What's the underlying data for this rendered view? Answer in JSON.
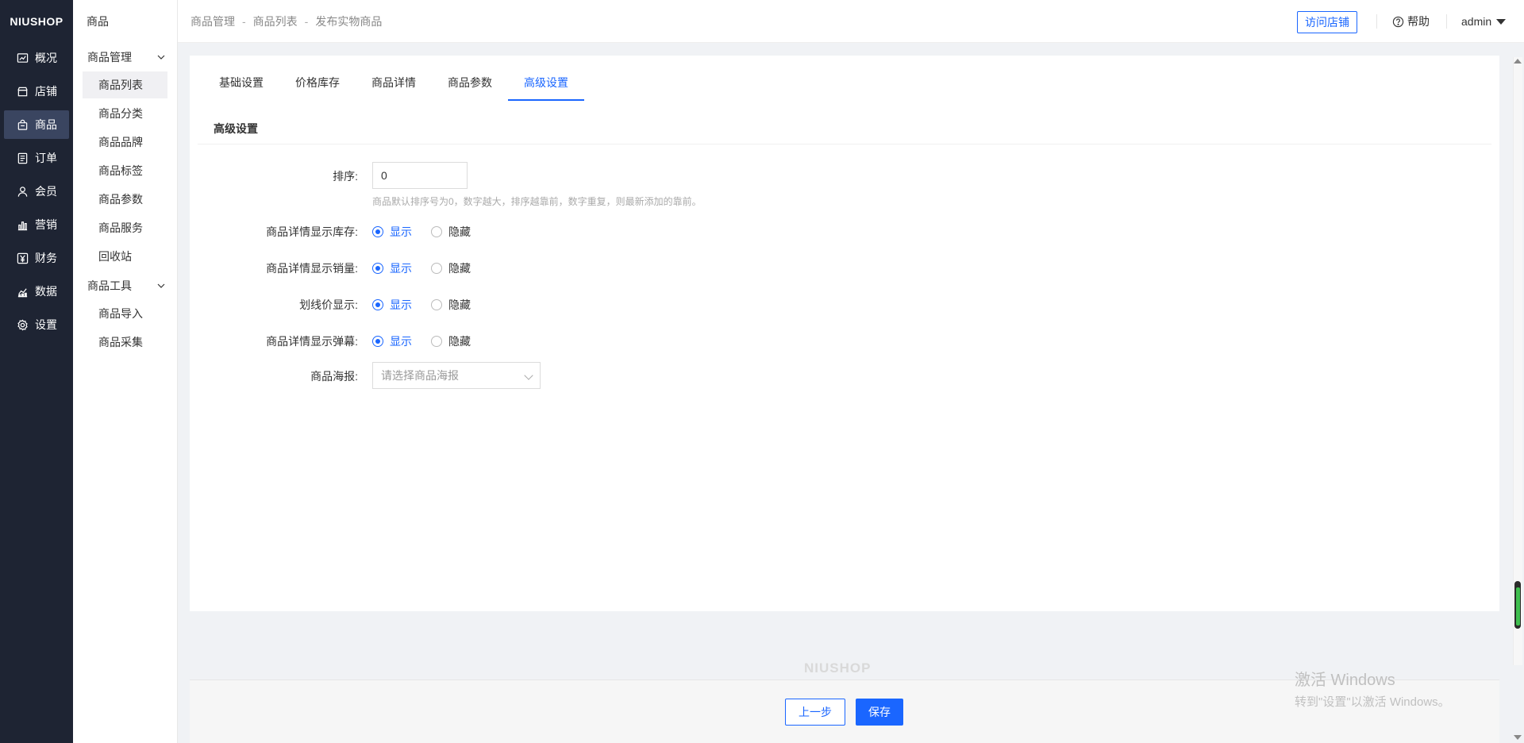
{
  "brand": "NIUSHOP",
  "main_nav": [
    {
      "label": "概况",
      "icon": "chart-line-icon"
    },
    {
      "label": "店铺",
      "icon": "store-icon"
    },
    {
      "label": "商品",
      "icon": "bag-icon",
      "active": true
    },
    {
      "label": "订单",
      "icon": "order-list-icon"
    },
    {
      "label": "会员",
      "icon": "user-icon"
    },
    {
      "label": "营销",
      "icon": "bar-chart-icon"
    },
    {
      "label": "财务",
      "icon": "yen-icon"
    },
    {
      "label": "数据",
      "icon": "data-icon"
    },
    {
      "label": "设置",
      "icon": "gear-icon"
    }
  ],
  "sub_nav": {
    "title": "商品",
    "groups": [
      {
        "label": "商品管理",
        "items": [
          "商品列表",
          "商品分类",
          "商品品牌",
          "商品标签",
          "商品参数",
          "商品服务",
          "回收站"
        ]
      },
      {
        "label": "商品工具",
        "items": [
          "商品导入",
          "商品采集"
        ]
      }
    ]
  },
  "header": {
    "breadcrumb": [
      "商品管理",
      "商品列表",
      "发布实物商品"
    ],
    "breadcrumb_sep": "-",
    "visit_store": "访问店铺",
    "help": "帮助",
    "user": "admin"
  },
  "tabs": [
    "基础设置",
    "价格库存",
    "商品详情",
    "商品参数",
    "高级设置"
  ],
  "active_tab": "高级设置",
  "form": {
    "section_title": "高级设置",
    "sort": {
      "label": "排序:",
      "value": "0",
      "hint": "商品默认排序号为0，数字越大，排序越靠前，数字重复，则最新添加的靠前。"
    },
    "show_stock": {
      "label": "商品详情显示库存:",
      "options": [
        "显示",
        "隐藏"
      ],
      "selected": "显示"
    },
    "show_sales": {
      "label": "商品详情显示销量:",
      "options": [
        "显示",
        "隐藏"
      ],
      "selected": "显示"
    },
    "show_line_price": {
      "label": "划线价显示:",
      "options": [
        "显示",
        "隐藏"
      ],
      "selected": "显示"
    },
    "show_barrage": {
      "label": "商品详情显示弹幕:",
      "options": [
        "显示",
        "隐藏"
      ],
      "selected": "显示"
    },
    "poster": {
      "label": "商品海报:",
      "placeholder": "请选择商品海报"
    }
  },
  "footer": {
    "watermark": "NIUSHOP",
    "prev": "上一步",
    "save": "保存"
  },
  "windows_watermark": {
    "line1": "激活 Windows",
    "line2": "转到\"设置\"以激活 Windows。"
  },
  "colors": {
    "accent": "#1a66ff",
    "sidebar_bg": "#1e2433"
  }
}
